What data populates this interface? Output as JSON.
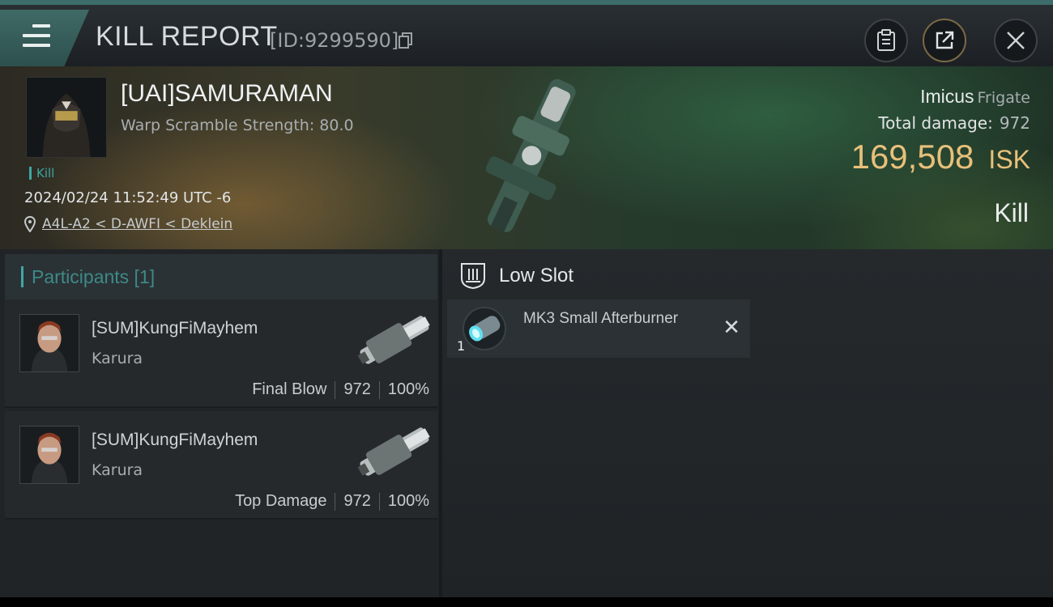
{
  "header": {
    "title": "KILL REPORT",
    "report_id": "[ID:9299590]"
  },
  "victim": {
    "name": "[UAI]SAMURAMAN",
    "subtitle": "Warp Scramble Strength: 80.0",
    "tag": "Kill",
    "timestamp": "2024/02/24 11:52:49 UTC -6",
    "location": "A4L-A2 < D-AWFI < Deklein",
    "ship_name": "Imicus",
    "ship_class": "Frigate",
    "damage_label": "Total damage:",
    "damage_value": "972",
    "isk_value": "169,508",
    "isk_unit": "ISK",
    "result": "Kill"
  },
  "participants": {
    "header": "Participants [1]",
    "items": [
      {
        "name": "[SUM]KungFiMayhem",
        "ship": "Karura",
        "role": "Final Blow",
        "damage": "972",
        "percent": "100%"
      },
      {
        "name": "[SUM]KungFiMayhem",
        "ship": "Karura",
        "role": "Top Damage",
        "damage": "972",
        "percent": "100%"
      }
    ]
  },
  "slots": {
    "title": "Low Slot",
    "modules": [
      {
        "quantity": "1",
        "name": "MK3 Small Afterburner"
      }
    ]
  },
  "colors": {
    "accent_teal": "#3fa7a3",
    "isk_gold": "#e8c07a"
  }
}
